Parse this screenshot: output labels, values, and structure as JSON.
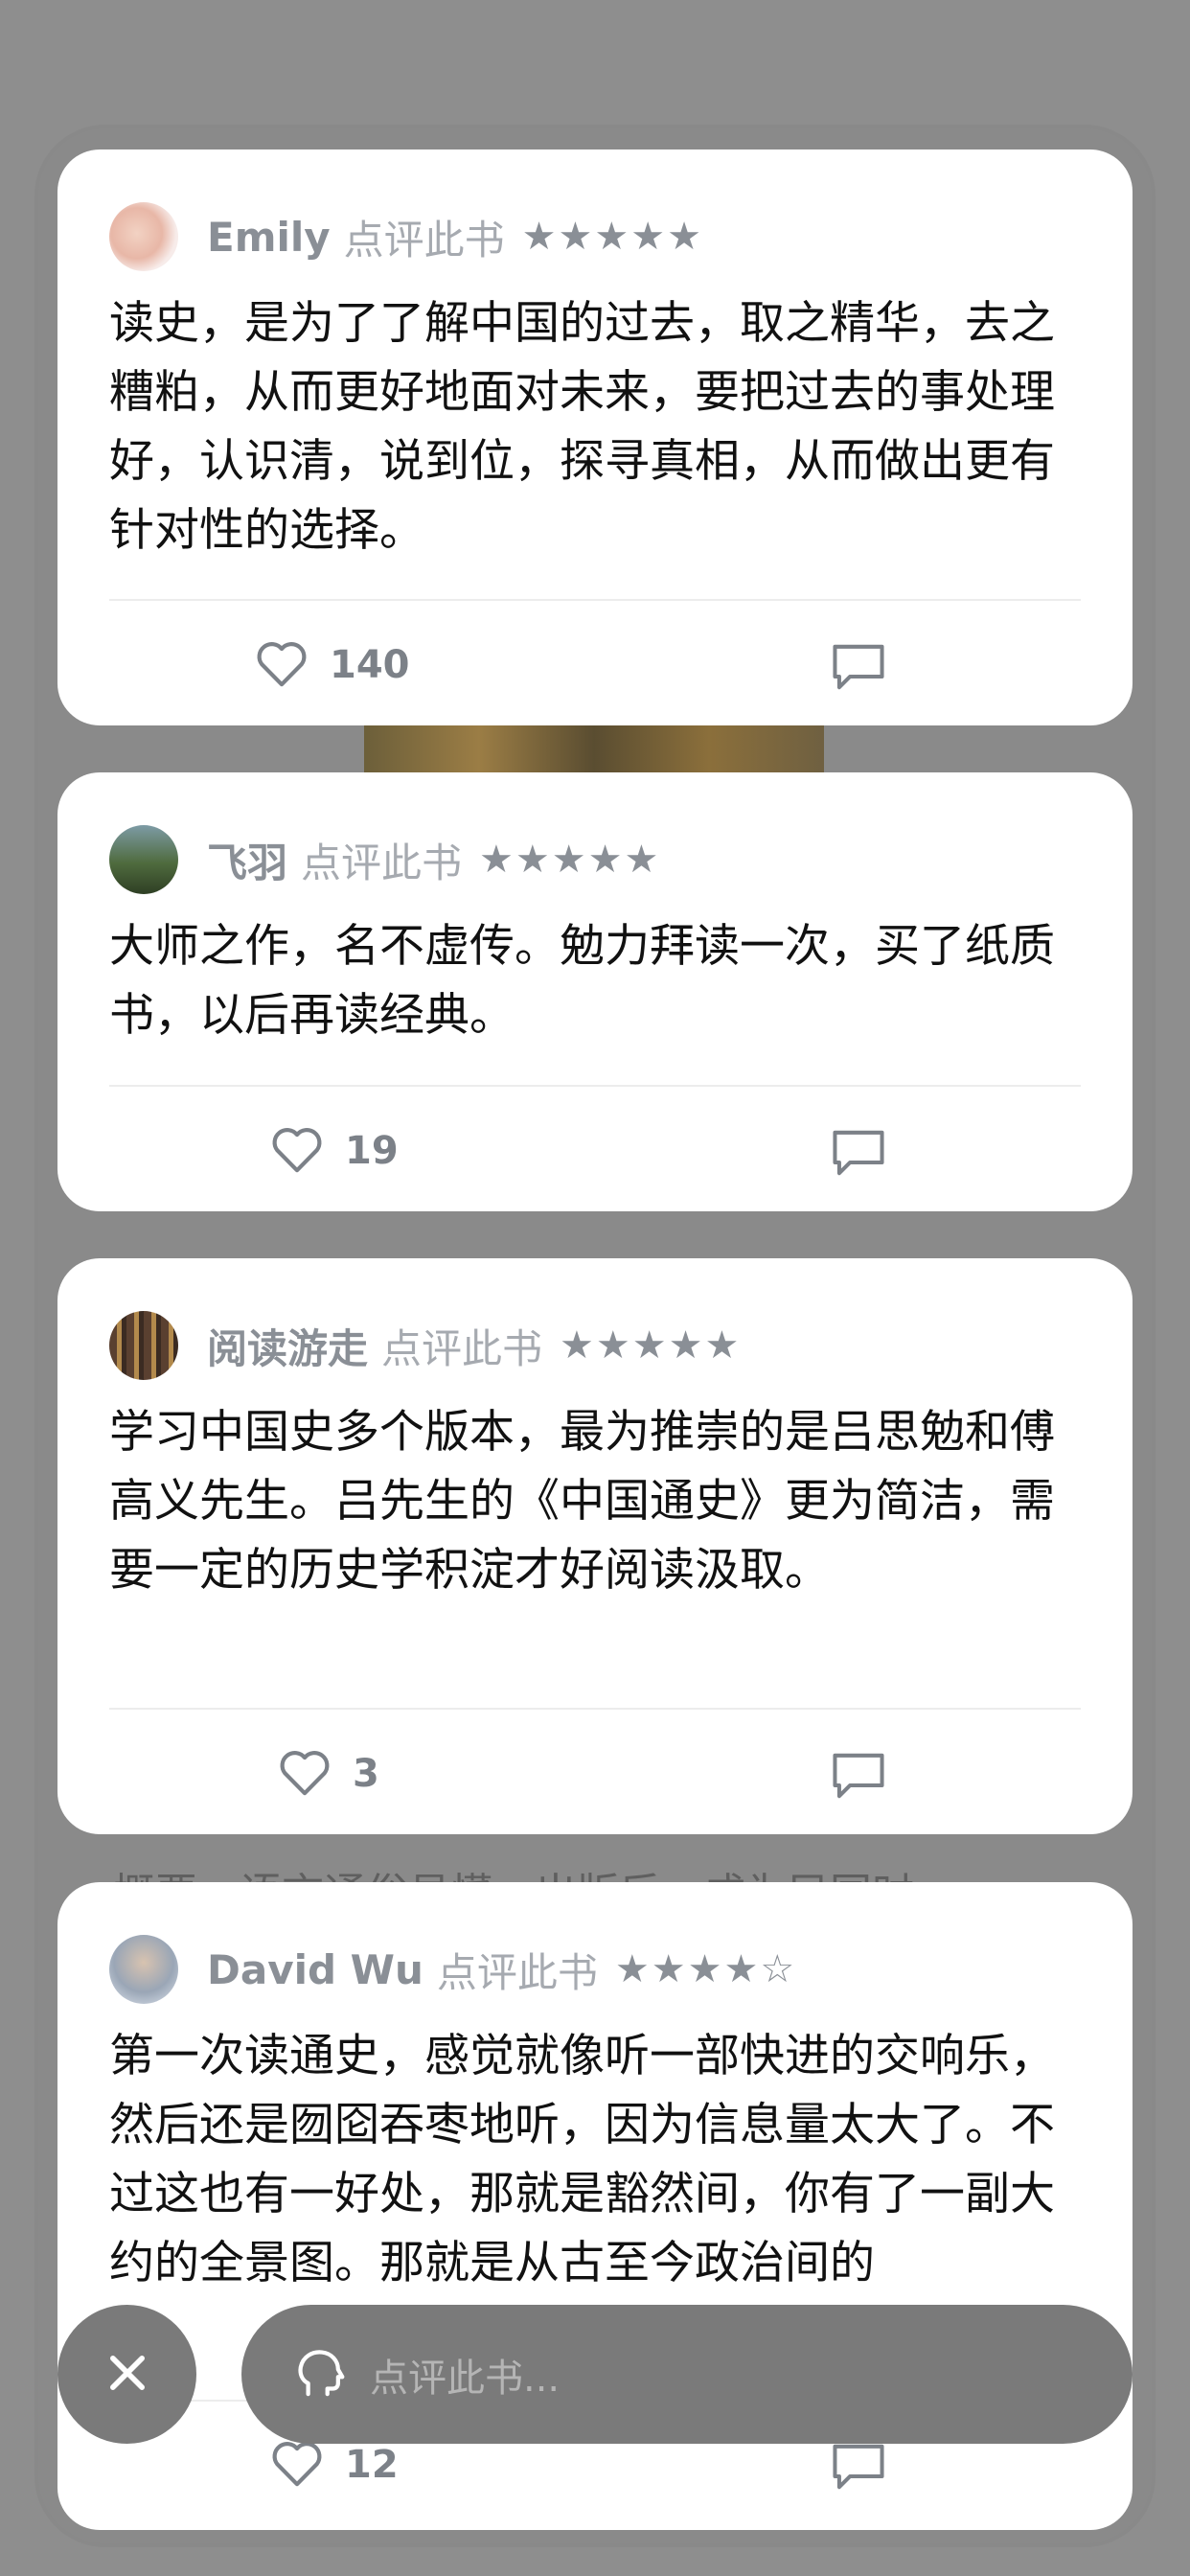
{
  "reviews": [
    {
      "user": "Emily",
      "action": "点评此书",
      "stars": "★★★★★",
      "text": "读史，是为了了解中国的过去，取之精华，去之糟粕，从而更好地面对未来，要把过去的事处理好，认识清，说到位，探寻真相，从而做出更有针对性的选择。",
      "likes": "140"
    },
    {
      "user": "飞羽",
      "action": "点评此书",
      "stars": "★★★★★",
      "text": "大师之作，名不虚传。勉力拜读一次，买了纸质书，以后再读经典。",
      "likes": "19"
    },
    {
      "user": "阅读游走",
      "action": "点评此书",
      "stars": "★★★★★",
      "text": "学习中国史多个版本，最为推崇的是吕思勉和傅高义先生。吕先生的《中国通史》更为简洁，需要一定的历史学积淀才好阅读汲取。",
      "likes": "3"
    },
    {
      "user": "David Wu",
      "action": "点评此书",
      "stars": "★★★★☆",
      "text": "第一次读通史，感觉就像听一部快进的交响乐，然后还是囫囵吞枣地听，因为信息量太大了。不过这也有一好处，那就是豁然间，你有了一副大约的全景图。那就是从古至今政治间的",
      "likes": "12"
    }
  ],
  "background_text": "概要，语言通俗易懂。出版后，成为民国时",
  "comment_input": {
    "placeholder": "点评此书..."
  },
  "icons": {
    "like": "heart-outline-icon",
    "comment": "comment-bubble-icon",
    "close": "close-icon",
    "input": "speech-head-icon"
  }
}
